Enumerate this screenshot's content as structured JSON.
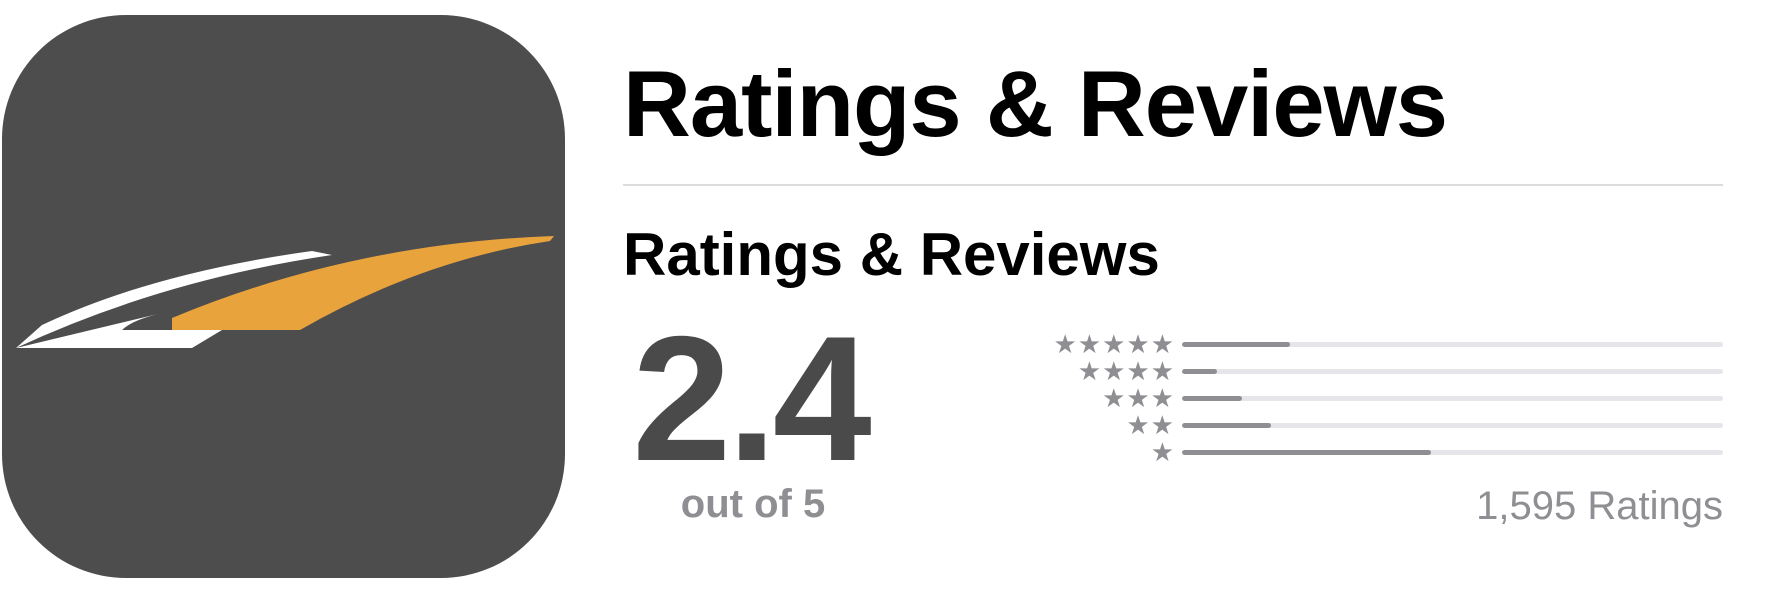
{
  "app": {
    "icon_name": "road-logo-icon",
    "icon_background": "#4d4d4d",
    "icon_accent": "#e8a33d"
  },
  "header": {
    "title": "Ratings & Reviews"
  },
  "ratings": {
    "section_title": "Ratings & Reviews",
    "average": "2.4",
    "out_of_label": "out of 5",
    "count_label": "1,595 Ratings",
    "bar_color": "#8e8e93",
    "track_color": "#e5e5ea",
    "distribution": [
      {
        "stars": 5,
        "star_glyphs": "★★★★★",
        "fraction": 0.2
      },
      {
        "stars": 4,
        "star_glyphs": "★★★★",
        "fraction": 0.065
      },
      {
        "stars": 3,
        "star_glyphs": "★★★",
        "fraction": 0.11
      },
      {
        "stars": 2,
        "star_glyphs": "★★",
        "fraction": 0.165
      },
      {
        "stars": 1,
        "star_glyphs": "★",
        "fraction": 0.46
      }
    ]
  }
}
